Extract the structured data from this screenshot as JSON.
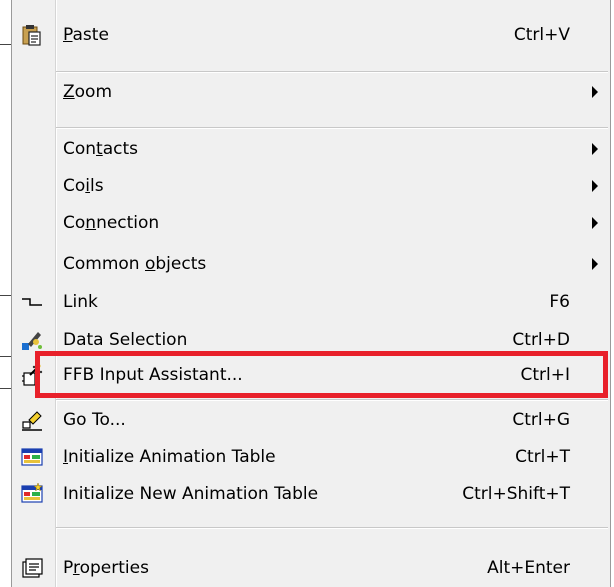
{
  "menu": {
    "items": [
      {
        "id": "paste",
        "label": "Paste",
        "mnemonic_index": 0,
        "shortcut": "Ctrl+V",
        "icon": "clipboard-paste-icon"
      },
      {
        "id": "zoom",
        "label": "Zoom",
        "mnemonic_index": 0,
        "submenu": true
      },
      {
        "id": "contacts",
        "label": "Contacts",
        "mnemonic_index": 3,
        "submenu": true
      },
      {
        "id": "coils",
        "label": "Coils",
        "mnemonic_index": 2,
        "submenu": true
      },
      {
        "id": "connection",
        "label": "Connection",
        "mnemonic_index": 2,
        "submenu": true
      },
      {
        "id": "common-objects",
        "label": "Common objects",
        "mnemonic_index": 7,
        "submenu": true
      },
      {
        "id": "link",
        "label": "Link",
        "shortcut": "F6",
        "icon": "link-wire-icon"
      },
      {
        "id": "data-selection",
        "label": "Data Selection",
        "shortcut": "Ctrl+D",
        "icon": "data-selection-icon"
      },
      {
        "id": "ffb-input-assistant",
        "label": "FFB Input Assistant...",
        "shortcut": "Ctrl+I",
        "icon": "ffb-assistant-icon"
      },
      {
        "id": "go-to",
        "label": "Go To...",
        "shortcut": "Ctrl+G",
        "icon": "goto-icon"
      },
      {
        "id": "init-animation-table",
        "label": "Initialize Animation Table",
        "mnemonic_index": 0,
        "shortcut": "Ctrl+T",
        "icon": "animation-table-icon"
      },
      {
        "id": "init-new-animation-table",
        "label": "Initialize New Animation Table",
        "shortcut": "Ctrl+Shift+T",
        "icon": "new-animation-table-icon"
      },
      {
        "id": "properties",
        "label": "Properties",
        "mnemonic_index": 1,
        "shortcut": "Alt+Enter",
        "icon": "properties-icon"
      }
    ]
  },
  "highlight_color": "#e8202a",
  "menu_background": "#f0f0f0"
}
